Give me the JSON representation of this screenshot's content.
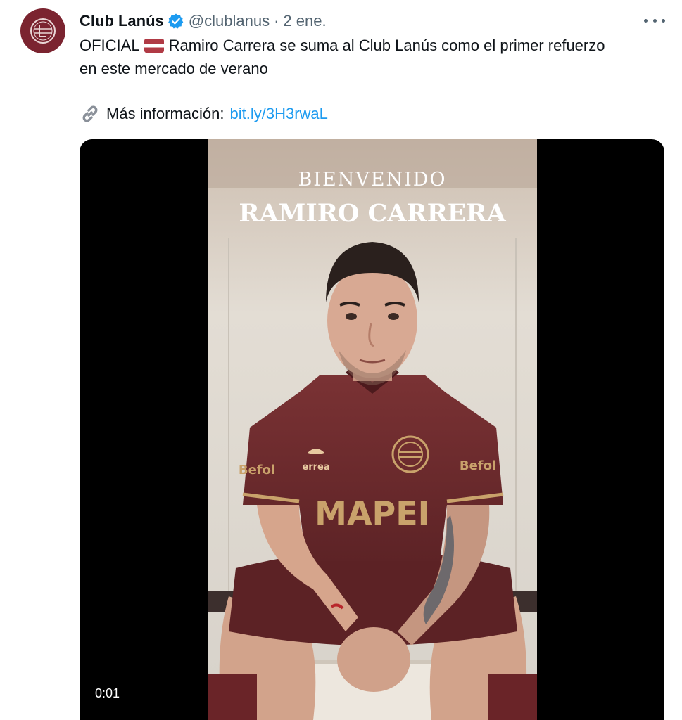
{
  "tweet": {
    "author_name": "Club Lanús",
    "handle": "@clublanus",
    "separator": "·",
    "timestamp": "2 ene.",
    "text_line1_a": "OFICIAL",
    "text_line1_b": "Ramiro Carrera se suma al Club Lanús como el primer refuerzo",
    "text_line2": "en este mercado de verano",
    "more_info_label": "Más información:",
    "link": "bit.ly/3H3rwaL"
  },
  "video": {
    "overlay_welcome": "BIENVENIDO",
    "overlay_name": "RAMIRO CARRERA",
    "time": "0:01",
    "jersey_sponsor": "MAPEI",
    "jersey_brand": "errea",
    "sleeve_sponsor_left": "Befol",
    "sleeve_sponsor_right": "Befol"
  },
  "colors": {
    "brand_maroon": "#7b2430",
    "link_blue": "#1d9bf0",
    "verified_blue": "#1d9bf0",
    "muted_gray": "#536471"
  },
  "icons": {
    "verified": "verified-badge-icon",
    "more": "more-icon",
    "link": "link-emoji-icon",
    "flag": "latvia-flag-emoji"
  }
}
